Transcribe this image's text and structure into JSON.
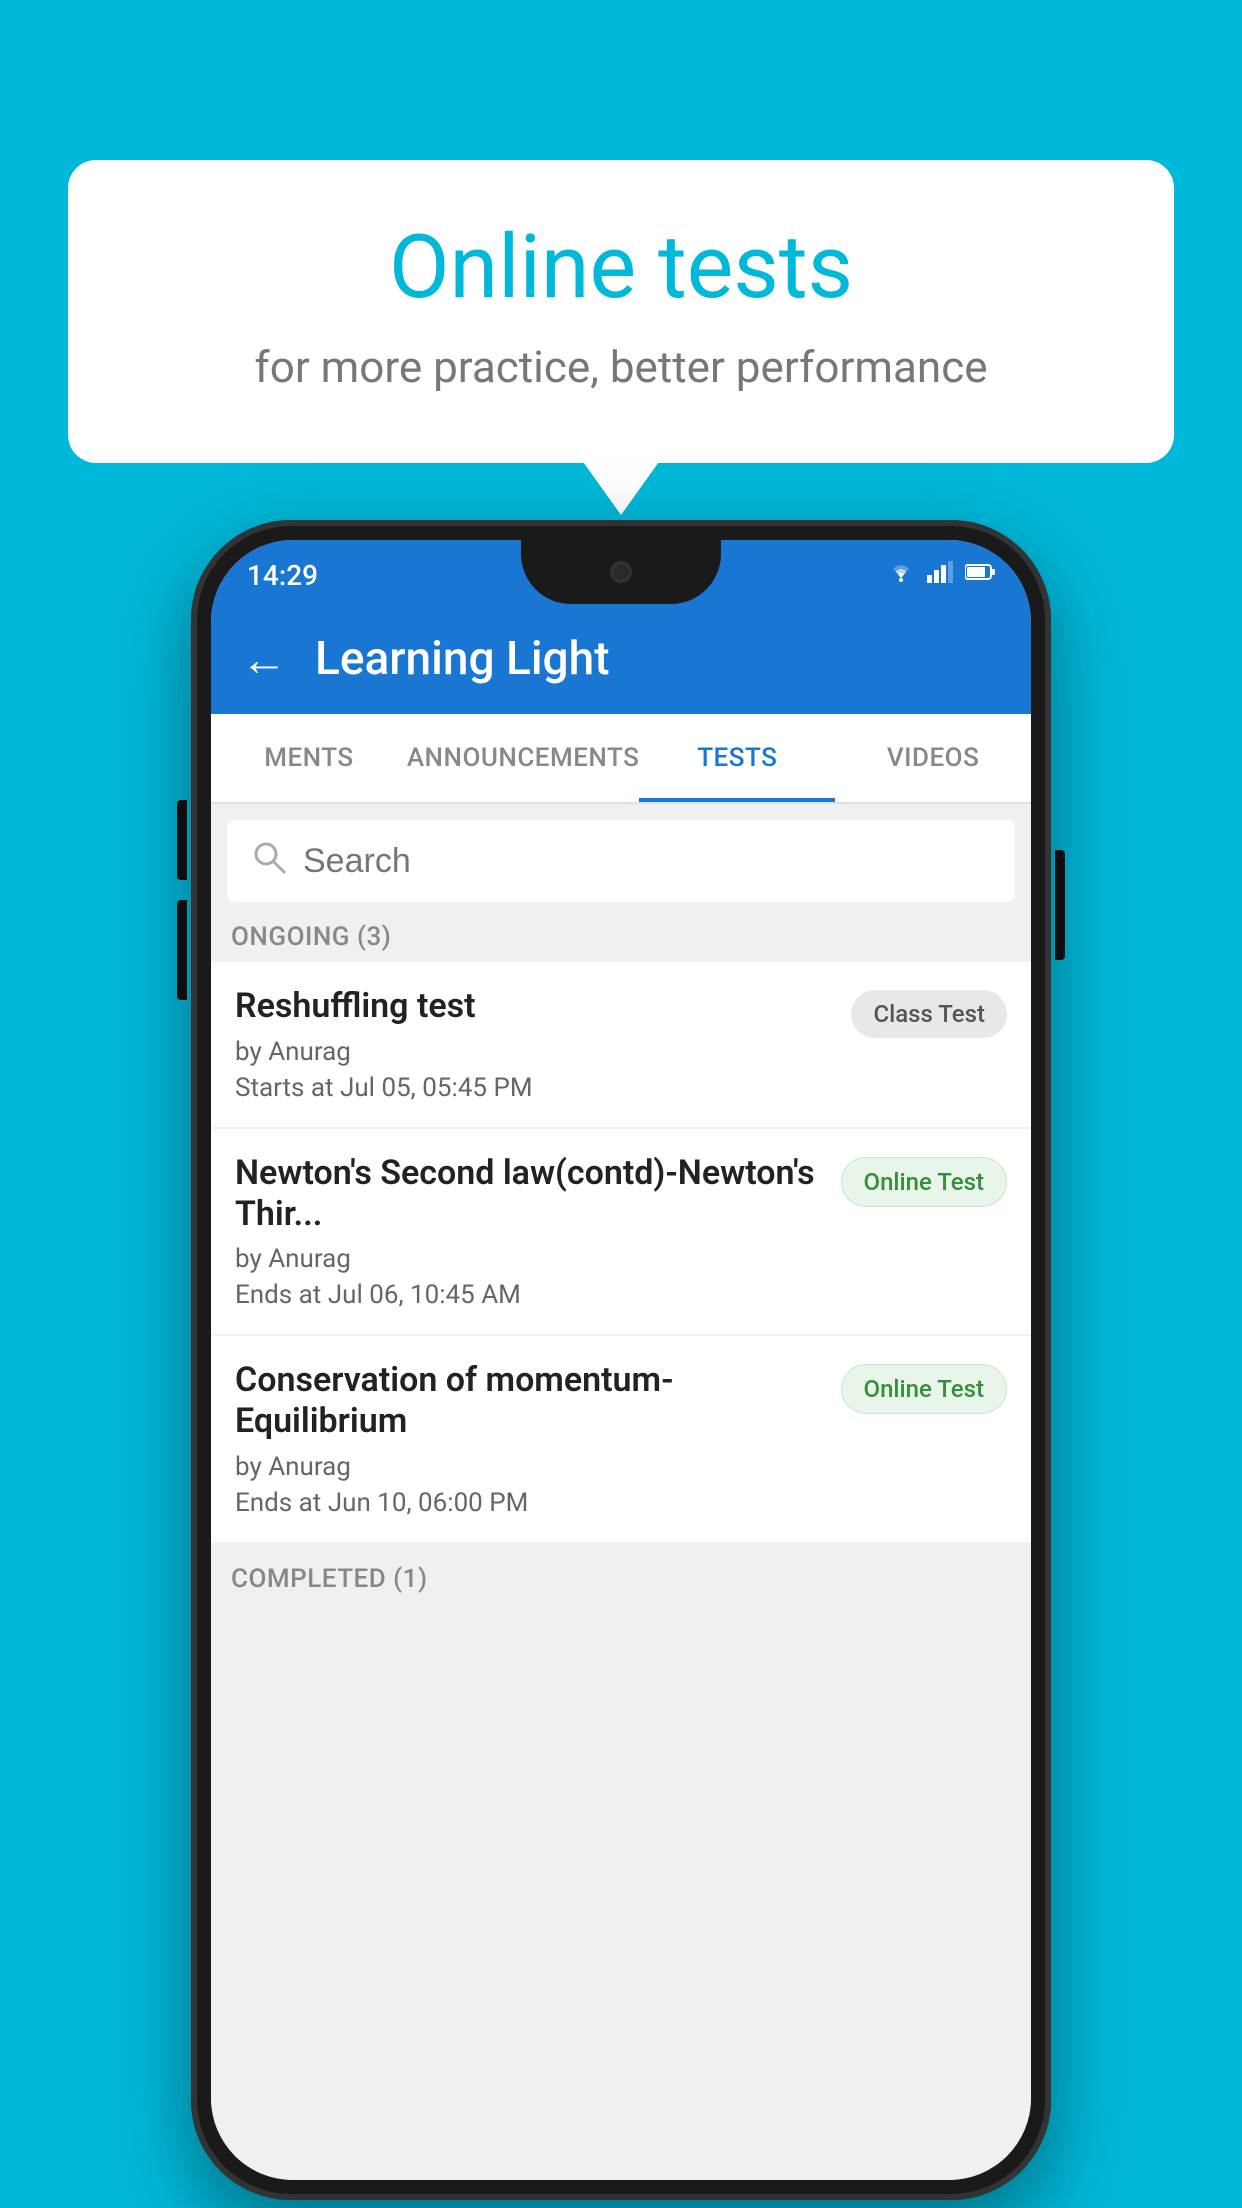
{
  "background_color": "#00b8d9",
  "speech_bubble": {
    "title": "Online tests",
    "subtitle": "for more practice, better performance"
  },
  "phone": {
    "status_bar": {
      "time": "14:29",
      "icons": [
        "wifi",
        "signal",
        "battery"
      ]
    },
    "app_bar": {
      "back_label": "←",
      "title": "Learning Light"
    },
    "tabs": [
      {
        "label": "MENTS",
        "active": false
      },
      {
        "label": "ANNOUNCEMENTS",
        "active": false
      },
      {
        "label": "TESTS",
        "active": true
      },
      {
        "label": "VIDEOS",
        "active": false
      }
    ],
    "search": {
      "placeholder": "Search"
    },
    "sections": [
      {
        "label": "ONGOING (3)",
        "items": [
          {
            "name": "Reshuffling test",
            "by": "by Anurag",
            "date": "Starts at  Jul 05, 05:45 PM",
            "badge": "Class Test",
            "badge_type": "class"
          },
          {
            "name": "Newton's Second law(contd)-Newton's Thir...",
            "by": "by Anurag",
            "date": "Ends at  Jul 06, 10:45 AM",
            "badge": "Online Test",
            "badge_type": "online"
          },
          {
            "name": "Conservation of momentum-Equilibrium",
            "by": "by Anurag",
            "date": "Ends at  Jun 10, 06:00 PM",
            "badge": "Online Test",
            "badge_type": "online"
          }
        ]
      }
    ],
    "completed_label": "COMPLETED (1)"
  }
}
